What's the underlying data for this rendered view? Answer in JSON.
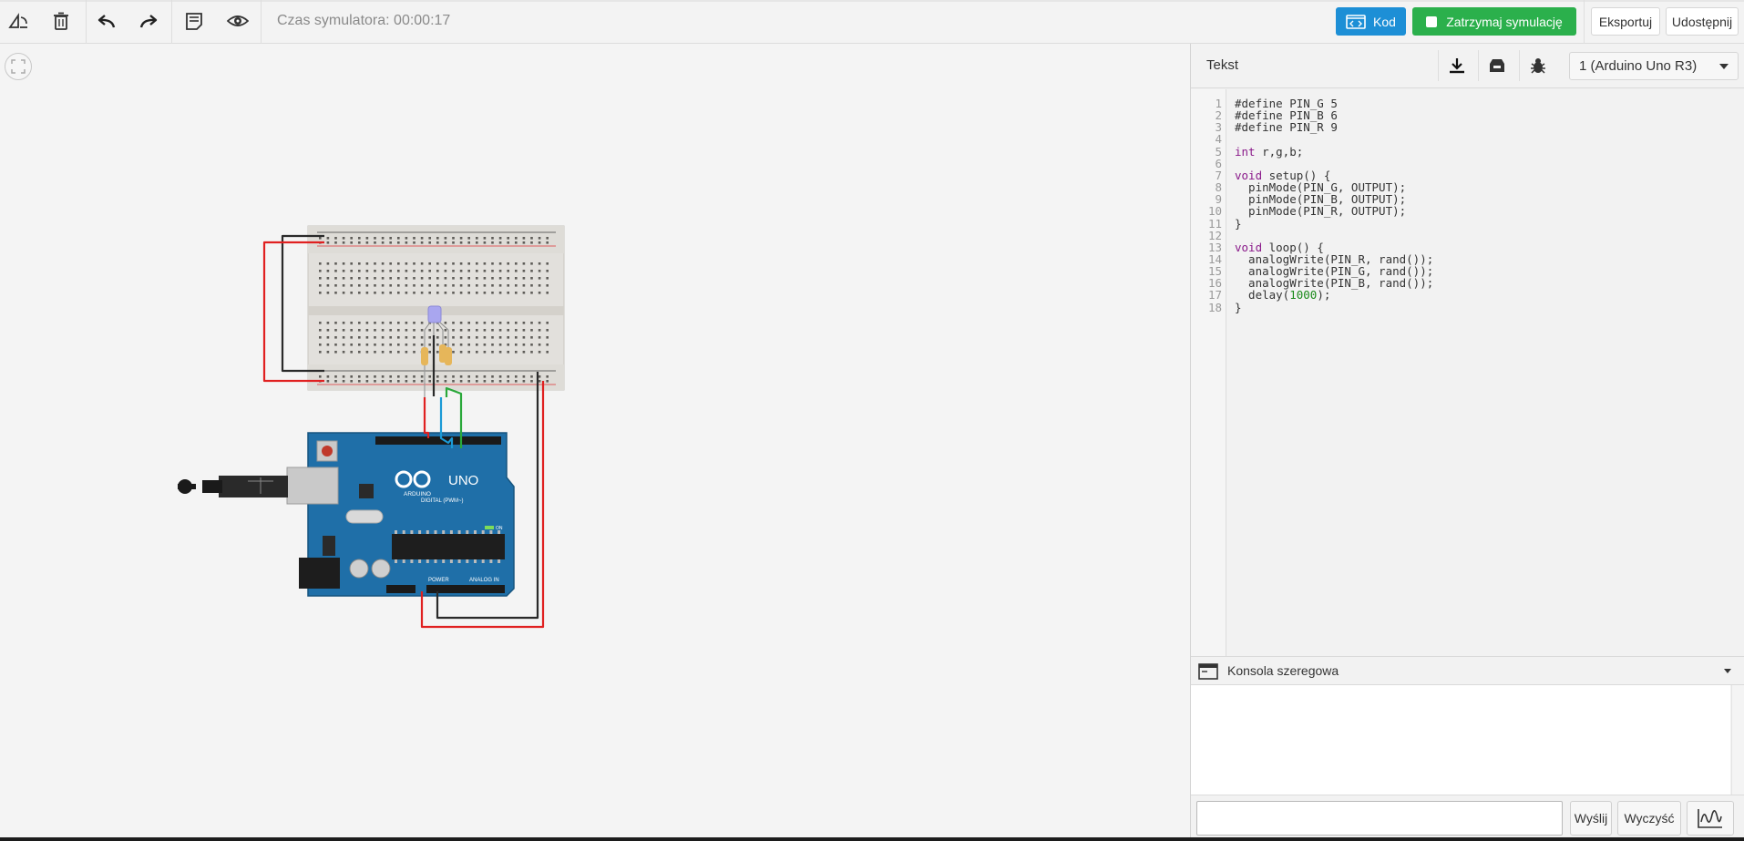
{
  "toolbar": {
    "icons": [
      "rotate-icon",
      "trash-icon",
      "undo-icon",
      "redo-icon",
      "notes-icon",
      "eye-icon"
    ],
    "sim_time": "Czas symulatora: 00:00:17",
    "code_button": "Kod",
    "stop_button": "Zatrzymaj symulację",
    "export_button": "Eksportuj",
    "share_button": "Udostępnij",
    "colors": {
      "code": "#1d8fd6",
      "stop": "#2bb04c"
    }
  },
  "canvas": {
    "board_labels": {
      "digital": "DIGITAL (PWM~)",
      "uno": "UNO",
      "arduino": "ARDUINO",
      "power": "POWER",
      "analog": "ANALOG IN",
      "on": "ON"
    }
  },
  "panel": {
    "mode": "Tekst",
    "device": "1 (Arduino Uno R3)",
    "code_lines": [
      "#define PIN_G 5",
      "#define PIN_B 6",
      "#define PIN_R 9",
      "",
      "int r,g,b;",
      "",
      "void setup() {",
      "  pinMode(PIN_G, OUTPUT);",
      "  pinMode(PIN_B, OUTPUT);",
      "  pinMode(PIN_R, OUTPUT);",
      "}",
      "",
      "void loop() {",
      "  analogWrite(PIN_R, rand());",
      "  analogWrite(PIN_G, rand());",
      "  analogWrite(PIN_B, rand());",
      "  delay(1000);",
      "}"
    ],
    "console_title": "Konsola szeregowa",
    "console_input": "",
    "send_button": "Wyślij",
    "clear_button": "Wyczyść"
  }
}
